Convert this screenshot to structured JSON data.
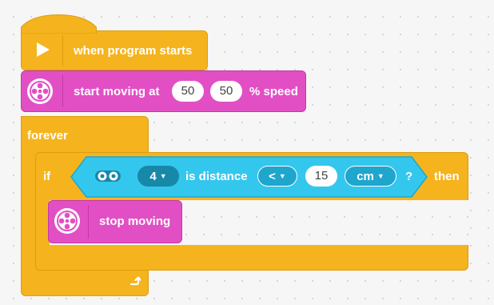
{
  "hat_block": {
    "label": "when program starts",
    "icon": "play-icon"
  },
  "move_block": {
    "label": "start moving at",
    "value_left": "50",
    "value_right": "50",
    "suffix": "% speed",
    "icon": "motor-pair-icon"
  },
  "forever_block": {
    "label": "forever",
    "loop_icon": "loop-arrow-icon"
  },
  "if_block": {
    "label": "if",
    "then_label": "then"
  },
  "distance_condition": {
    "icon": "distance-sensor-icon",
    "port": "4",
    "label": "is distance",
    "comparator": "<",
    "value": "15",
    "unit": "cm",
    "question": "?"
  },
  "stop_block": {
    "label": "stop moving",
    "icon": "motor-pair-icon"
  },
  "colors": {
    "events_yellow": "#f5b41d",
    "motors_pink": "#e24fc4",
    "sensors_cyan": "#34c7ee",
    "canvas": "#f6f6f6"
  }
}
